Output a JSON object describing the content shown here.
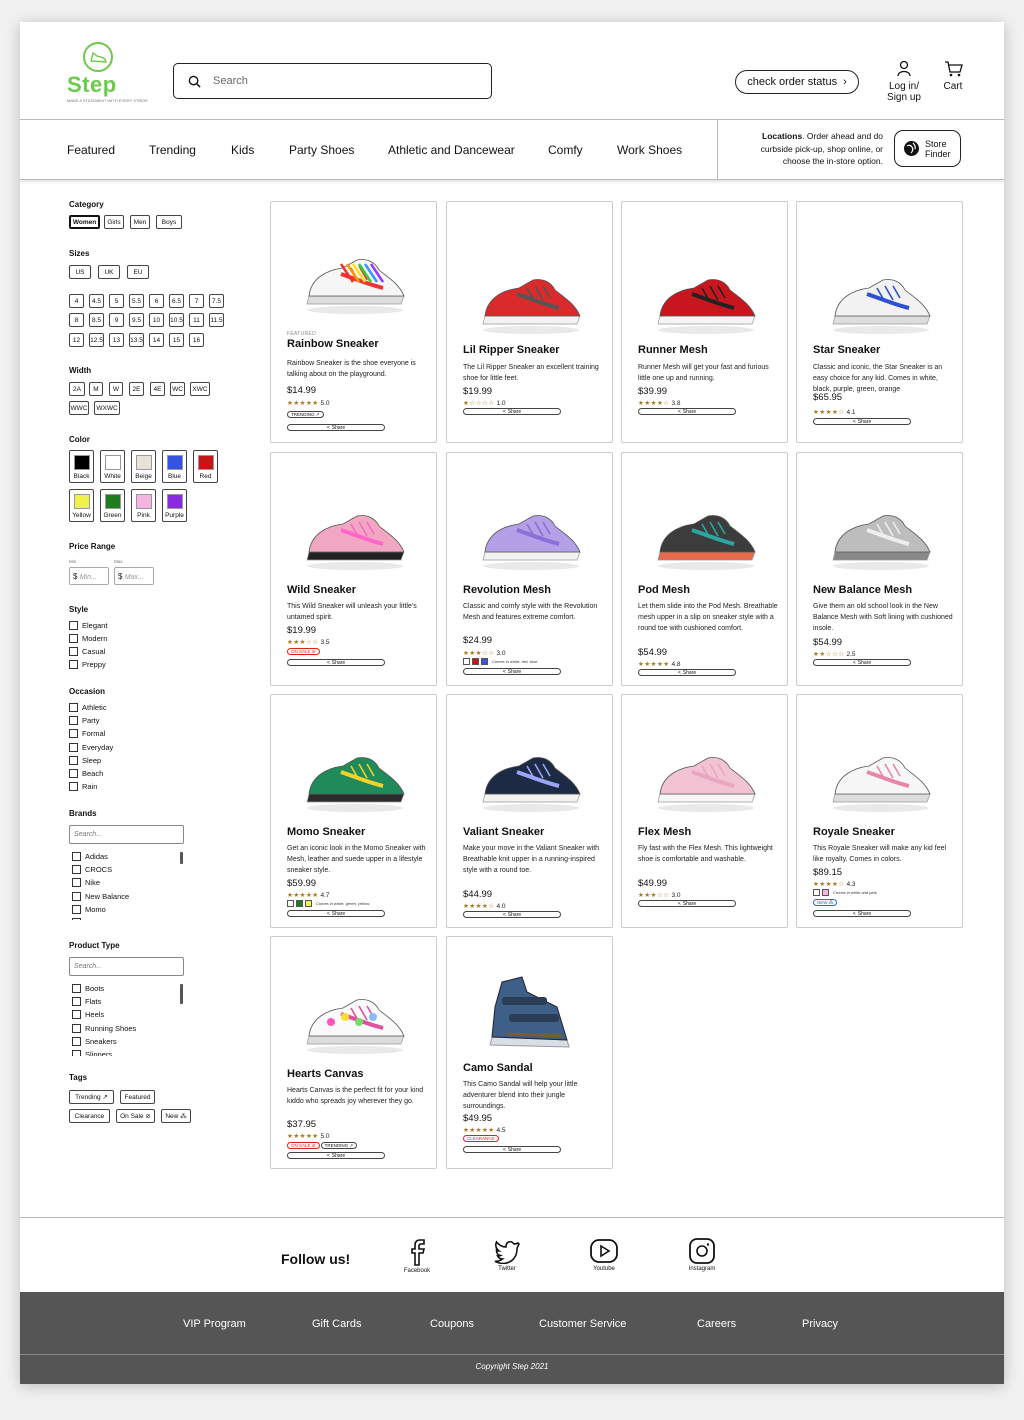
{
  "brand": {
    "name": "Step",
    "tagline": "MAKE A STATEMENT WITH EVERY STRIDE",
    "accent": "#6bc94b"
  },
  "header": {
    "search_placeholder": "Search",
    "order_status": "check order status",
    "account": "Log in/\nSign up",
    "cart": "Cart"
  },
  "nav": {
    "items": [
      "Featured",
      "Trending",
      "Kids",
      "Party Shoes",
      "Athletic and Dancewear",
      "Comfy",
      "Work Shoes"
    ],
    "locations_bold": "Locations",
    "locations_text": ". Order ahead and do curbside pick-up, shop online, or choose the in-store option.",
    "store_finder": "Store\nFinder"
  },
  "filters": {
    "category": {
      "title": "Category",
      "options": [
        "Women",
        "Girls",
        "Men",
        "Boys"
      ],
      "selected": "Women"
    },
    "sizes": {
      "title": "Sizes",
      "systems": [
        "US",
        "UK",
        "EU"
      ],
      "values": [
        "4",
        "4.5",
        "5",
        "5.5",
        "6",
        "6.5",
        "7",
        "7.5",
        "8",
        "8.5",
        "9",
        "9.5",
        "10",
        "10.5",
        "11",
        "11.5",
        "12",
        "12.5",
        "13",
        "13.5",
        "14",
        "15",
        "16"
      ]
    },
    "width": {
      "title": "Width",
      "values": [
        "2A",
        "M",
        "W",
        "2E",
        "4E",
        "WC",
        "XWC",
        "WWC",
        "WXWC"
      ]
    },
    "color": {
      "title": "Color",
      "values": [
        {
          "name": "Black",
          "hex": "#000000"
        },
        {
          "name": "White",
          "hex": "#ffffff"
        },
        {
          "name": "Beige",
          "hex": "#e8e1d6"
        },
        {
          "name": "Blue",
          "hex": "#3553e0"
        },
        {
          "name": "Red",
          "hex": "#c81414"
        },
        {
          "name": "Yellow",
          "hex": "#eef24a"
        },
        {
          "name": "Green",
          "hex": "#1e7d1e"
        },
        {
          "name": "Pink",
          "hex": "#f3b6e3"
        },
        {
          "name": "Purple",
          "hex": "#8a2be2"
        }
      ]
    },
    "price": {
      "title": "Price Range",
      "min_label": "Min",
      "max_label": "Max",
      "min_placeholder": "Min...",
      "max_placeholder": "Max...",
      "currency": "$"
    },
    "style": {
      "title": "Style",
      "options": [
        "Elegant",
        "Modern",
        "Casual",
        "Preppy"
      ]
    },
    "occasion": {
      "title": "Occasion",
      "options": [
        "Athletic",
        "Party",
        "Formal",
        "Everyday",
        "Sleep",
        "Beach",
        "Rain"
      ]
    },
    "brands": {
      "title": "Brands",
      "placeholder": "Search...",
      "options": [
        "Adidas",
        "CROCS",
        "Nike",
        "New Balance",
        "Momo",
        "Vans"
      ]
    },
    "product_type": {
      "title": "Product Type",
      "placeholder": "Search...",
      "options": [
        "Boots",
        "Flats",
        "Heels",
        "Running Shoes",
        "Sneakers",
        "Slippers"
      ]
    },
    "tags": {
      "title": "Tags",
      "values": [
        "Trending ↗",
        "Featured",
        "Clearance",
        "On Sale ⊘",
        "New ⁂"
      ]
    }
  },
  "products": [
    {
      "name": "Rainbow Sneaker",
      "label": "FEATURED",
      "desc": "Rainbow Sneaker is the shoe everyone is talking about on the playground.",
      "price": "$14.99",
      "rating": "5.0",
      "stars": "★★★★★",
      "badges": [
        {
          "text": "TRENDING ↗",
          "tone": "dark"
        }
      ]
    },
    {
      "name": "Lil Ripper Sneaker",
      "desc": "The Lil Ripper Sneaker an excellent training shoe for little feet.",
      "price": "$19.99",
      "rating": "1.0",
      "stars": "★☆☆☆☆",
      "badges": []
    },
    {
      "name": "Runner Mesh",
      "desc": "Runner Mesh will get your fast and furious little one up and running.",
      "price": "$39.99",
      "rating": "3.8",
      "stars": "★★★★☆",
      "badges": []
    },
    {
      "name": "Star Sneaker",
      "desc": "Classic and iconic, the Star Sneaker is an easy choice for any kid. Comes in white, black, purple, green, orange",
      "price": "$65.95",
      "rating": "4.1",
      "stars": "★★★★☆",
      "badges": []
    },
    {
      "name": "Wild Sneaker",
      "desc": "This Wild Sneaker will unleash your little's untamed spirit.",
      "price": "$19.99",
      "rating": "3.5",
      "stars": "★★★☆☆",
      "badges": [
        {
          "text": "ON SALE ⊘",
          "tone": "red"
        }
      ]
    },
    {
      "name": "Revolution Mesh",
      "desc": "Classic and comfy style with the Revolution Mesh and features extreme comfort.",
      "price": "$24.99",
      "rating": "3.0",
      "stars": "★★★☆☆",
      "badges": [],
      "colors_note": "Comes in white, red, blue.",
      "colors": [
        "#ffffff",
        "#c81414",
        "#3553e0"
      ]
    },
    {
      "name": "Pod Mesh",
      "desc": "Let them slide into the Pod Mesh. Breathable mesh upper in a slip on sneaker style with a round toe with cushioned comfort.",
      "price": "$54.99",
      "rating": "4.8",
      "stars": "★★★★★",
      "badges": []
    },
    {
      "name": "New Balance Mesh",
      "desc": "Give them an old school look in the New Balance Mesh with Soft lining with cushioned insole.",
      "price": "$54.99",
      "rating": "2.5",
      "stars": "★★☆☆☆",
      "badges": []
    },
    {
      "name": "Momo Sneaker",
      "desc": "Get an iconic look in the Momo Sneaker with Mesh, leather and suede upper in a lifestyle sneaker style.",
      "price": "$59.99",
      "rating": "4.7",
      "stars": "★★★★★",
      "badges": [],
      "colors_note": "Comes in white, green, yellow.",
      "colors": [
        "#ffffff",
        "#1e7d1e",
        "#eef24a"
      ]
    },
    {
      "name": "Valiant Sneaker",
      "desc": "Make your move in the Valiant Sneaker with Breathable knit upper in a running-inspired style with a round toe.",
      "price": "$44.99",
      "rating": "4.0",
      "stars": "★★★★☆",
      "badges": []
    },
    {
      "name": "Flex Mesh",
      "desc": "Fly fast with the Flex Mesh. This lightweight shoe is comfortable and washable.",
      "price": "$49.99",
      "rating": "3.0",
      "stars": "★★★☆☆",
      "badges": []
    },
    {
      "name": "Royale Sneaker",
      "desc": "This Royale Sneaker will make any kid feel like royalty. Comes in colors.",
      "price": "$89.15",
      "rating": "4.3",
      "stars": "★★★★☆",
      "badges": [
        {
          "text": "NEW ⁂",
          "tone": "blue"
        }
      ],
      "colors_note": "Comes in white and pink.",
      "colors": [
        "#ffffff",
        "#f3b6e3"
      ]
    },
    {
      "name": "Hearts Canvas",
      "desc": "Hearts Canvas is the perfect fit for your kind kiddo who spreads joy wherever they go.",
      "price": "$37.95",
      "rating": "5.0",
      "stars": "★★★★★",
      "badges": [
        {
          "text": "ON SALE ⊘",
          "tone": "red"
        },
        {
          "text": "TRENDING ↗",
          "tone": "dark"
        }
      ]
    },
    {
      "name": "Camo Sandal",
      "desc": "This Camo Sandal will help your little adventurer blend into their jungle surroundings.",
      "price": "$49.95",
      "rating": "4.5",
      "stars": "★★★★★",
      "badges": [
        {
          "text": "CLEARANCE",
          "tone": "red"
        }
      ]
    }
  ],
  "share_label": "Share",
  "social": {
    "title": "Follow us!",
    "items": [
      "Facebook",
      "Twitter",
      "Youtube",
      "Instagram"
    ]
  },
  "footer": {
    "links": [
      "VIP Program",
      "Gift Cards",
      "Coupons",
      "Customer Service",
      "Careers",
      "Privacy"
    ],
    "copyright": "Copyright Step 2021"
  }
}
